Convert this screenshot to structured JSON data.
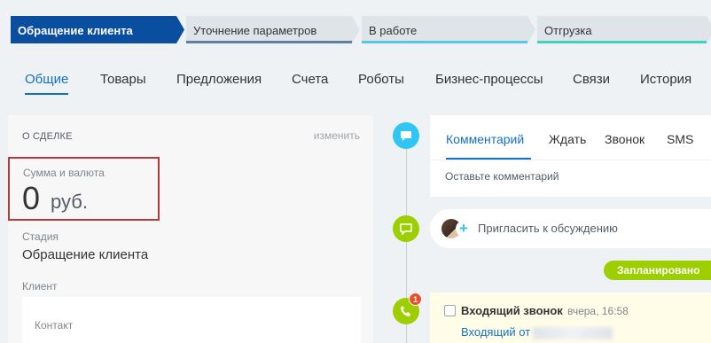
{
  "stages": [
    {
      "label": "Обращение клиента",
      "color": "#0a4ea0",
      "active": true
    },
    {
      "label": "Уточнение параметров",
      "color": "#5e7fa1",
      "active": false
    },
    {
      "label": "В работе",
      "color": "#55c8e3",
      "active": false
    },
    {
      "label": "Отгрузка",
      "color": "#3fd3bd",
      "active": false
    }
  ],
  "tabs": [
    "Общие",
    "Товары",
    "Предложения",
    "Счета",
    "Роботы",
    "Бизнес-процессы",
    "Связи",
    "История"
  ],
  "active_tab": "Общие",
  "deal": {
    "section_title": "О СДЕЛКЕ",
    "edit_label": "изменить",
    "amount_label": "Сумма и валюта",
    "amount_value": "0",
    "currency": "руб.",
    "stage_label": "Стадия",
    "stage_value": "Обращение клиента",
    "client_label": "Клиент",
    "contact_label": "Контакт"
  },
  "timeline": {
    "comment_tabs": [
      "Комментарий",
      "Ждать",
      "Звонок",
      "SMS"
    ],
    "active_comment_tab": "Комментарий",
    "comment_placeholder": "Оставьте комментарий",
    "invite_text": "Пригласить к обсуждению",
    "planned_label": "Запланировано",
    "call": {
      "badge_count": "1",
      "title": "Входящий звонок",
      "time": "вчера, 16:58",
      "link_text": "Входящий от"
    }
  },
  "colors": {
    "accent": "#1570c3",
    "timeline_blue": "#2fc6f6",
    "timeline_green": "#9dcf00",
    "highlight_border": "#b23a38"
  }
}
